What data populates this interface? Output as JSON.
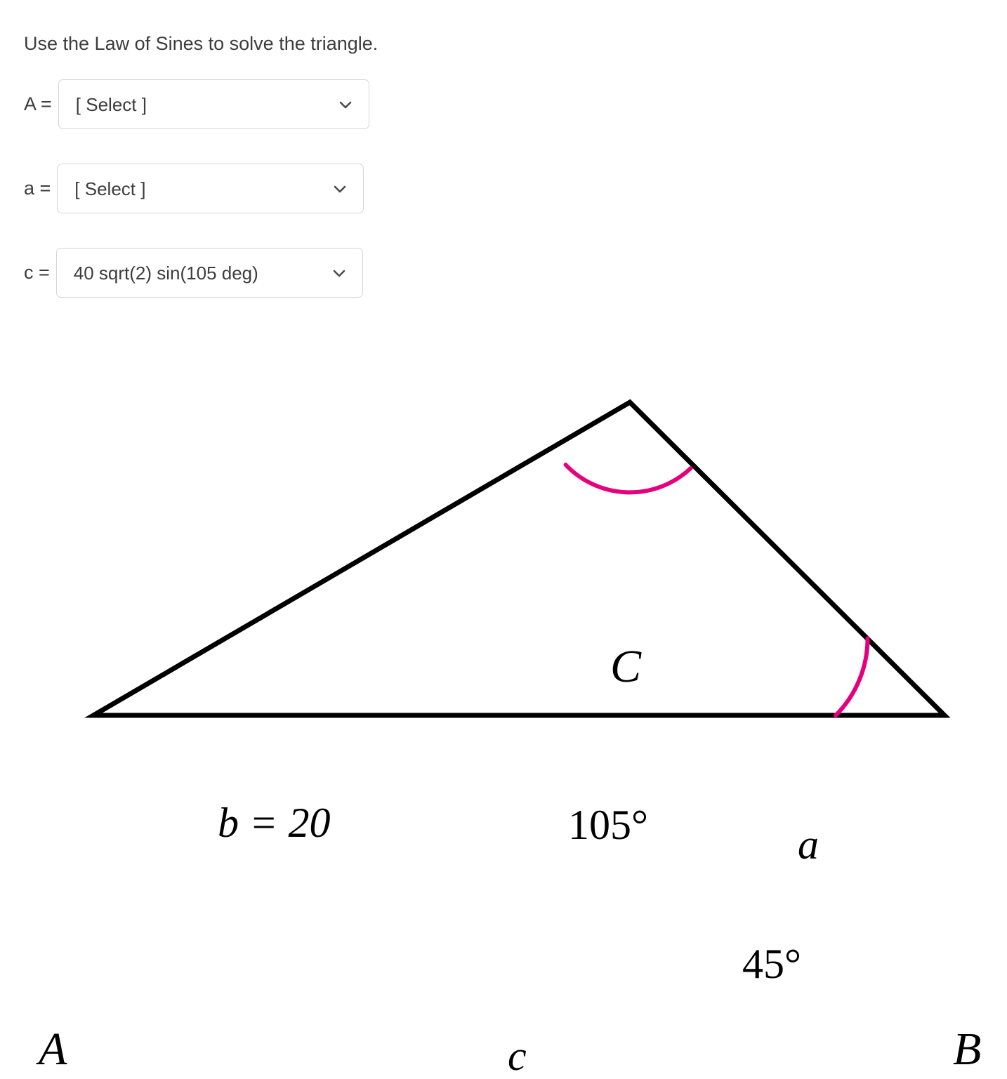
{
  "prompt": "Use the Law of Sines to solve the triangle.",
  "fields": [
    {
      "id": "A",
      "label": "A =",
      "value": "[ Select ]",
      "icon": "chevron-down-icon"
    },
    {
      "id": "a",
      "label": "a =",
      "value": "[ Select ]",
      "icon": "chevron-down-icon"
    },
    {
      "id": "c",
      "label": "c =",
      "value": "40 sqrt(2) sin(105 deg)",
      "icon": "chevron-down-icon"
    }
  ],
  "figure": {
    "vertices": {
      "A": "A",
      "B": "B",
      "C": "C"
    },
    "sides": {
      "b": "b = 20",
      "a": "a",
      "c": "c"
    },
    "angles": {
      "C": "105°",
      "B": "45°"
    },
    "colors": {
      "stroke": "#000000",
      "angle_arc": "#e5007e"
    }
  }
}
